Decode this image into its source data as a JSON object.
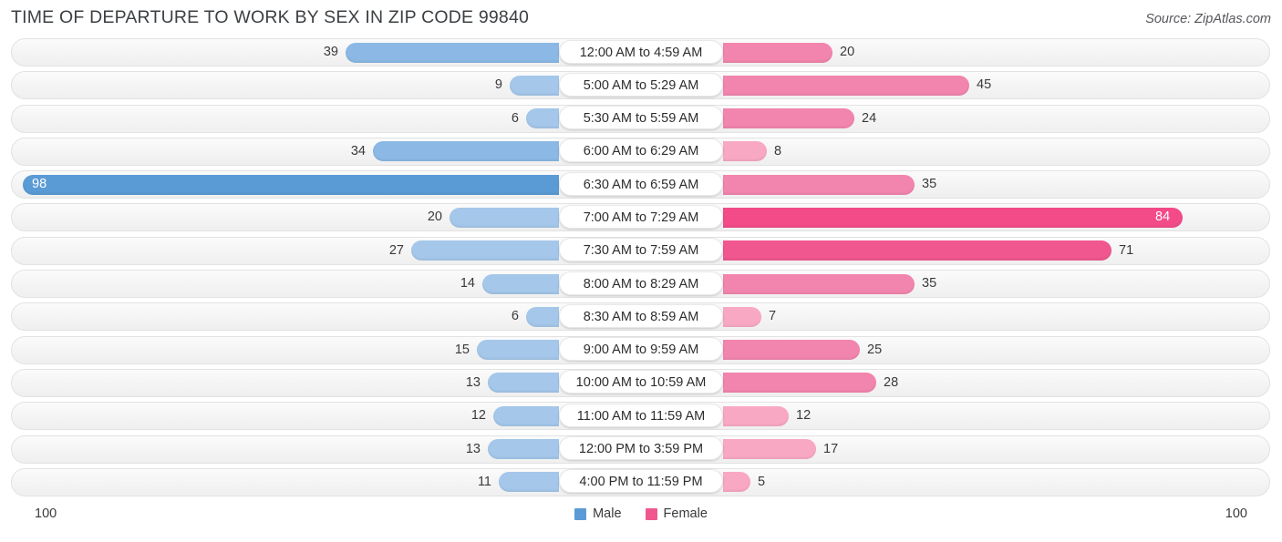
{
  "header": {
    "title": "TIME OF DEPARTURE TO WORK BY SEX IN ZIP CODE 99840",
    "source": "Source: ZipAtlas.com"
  },
  "legend": {
    "male_label": "Male",
    "female_label": "Female",
    "male_color": "#5b9bd5",
    "female_color": "#f0578f"
  },
  "axis": {
    "left_max": "100",
    "right_max": "100"
  },
  "colors": {
    "male_light": "#a4c7ea",
    "male_mid": "#8bb8e4",
    "male_dark": "#5b9bd5",
    "female_light": "#f9a8c4",
    "female_mid": "#f285ad",
    "female_dark": "#f0578f",
    "female_darkest": "#f24b87",
    "track_bg": "#f6f6f6",
    "track_border": "#e2e2e2"
  },
  "chart_data": {
    "type": "bar",
    "subtype": "diverging-bidirectional",
    "title": "TIME OF DEPARTURE TO WORK BY SEX IN ZIP CODE 99840",
    "xlabel": "",
    "ylabel": "",
    "xlim": [
      100,
      100
    ],
    "grid": false,
    "legend_position": "bottom-center",
    "categories": [
      "12:00 AM to 4:59 AM",
      "5:00 AM to 5:29 AM",
      "5:30 AM to 5:59 AM",
      "6:00 AM to 6:29 AM",
      "6:30 AM to 6:59 AM",
      "7:00 AM to 7:29 AM",
      "7:30 AM to 7:59 AM",
      "8:00 AM to 8:29 AM",
      "8:30 AM to 8:59 AM",
      "9:00 AM to 9:59 AM",
      "10:00 AM to 10:59 AM",
      "11:00 AM to 11:59 AM",
      "12:00 PM to 3:59 PM",
      "4:00 PM to 11:59 PM"
    ],
    "series": [
      {
        "name": "Male",
        "direction": "left",
        "values": [
          39,
          9,
          6,
          34,
          98,
          20,
          27,
          14,
          6,
          15,
          13,
          12,
          13,
          11
        ]
      },
      {
        "name": "Female",
        "direction": "right",
        "values": [
          20,
          45,
          24,
          8,
          35,
          84,
          71,
          35,
          7,
          25,
          28,
          12,
          17,
          5
        ]
      }
    ]
  },
  "rows": [
    {
      "label": "12:00 AM to 4:59 AM",
      "male": "39",
      "female": "20"
    },
    {
      "label": "5:00 AM to 5:29 AM",
      "male": "9",
      "female": "45"
    },
    {
      "label": "5:30 AM to 5:59 AM",
      "male": "6",
      "female": "24"
    },
    {
      "label": "6:00 AM to 6:29 AM",
      "male": "34",
      "female": "8"
    },
    {
      "label": "6:30 AM to 6:59 AM",
      "male": "98",
      "female": "35"
    },
    {
      "label": "7:00 AM to 7:29 AM",
      "male": "20",
      "female": "84"
    },
    {
      "label": "7:30 AM to 7:59 AM",
      "male": "27",
      "female": "71"
    },
    {
      "label": "8:00 AM to 8:29 AM",
      "male": "14",
      "female": "35"
    },
    {
      "label": "8:30 AM to 8:59 AM",
      "male": "6",
      "female": "7"
    },
    {
      "label": "9:00 AM to 9:59 AM",
      "male": "15",
      "female": "25"
    },
    {
      "label": "10:00 AM to 10:59 AM",
      "male": "13",
      "female": "28"
    },
    {
      "label": "11:00 AM to 11:59 AM",
      "male": "12",
      "female": "12"
    },
    {
      "label": "12:00 PM to 3:59 PM",
      "male": "13",
      "female": "17"
    },
    {
      "label": "4:00 PM to 11:59 PM",
      "male": "11",
      "female": "5"
    }
  ]
}
